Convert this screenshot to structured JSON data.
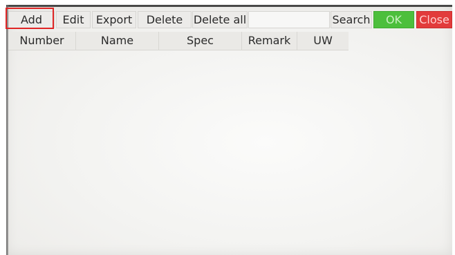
{
  "toolbar": {
    "add_label": "Add",
    "edit_label": "Edit",
    "export_label": "Export",
    "delete_label": "Delete",
    "delete_all_label": "Delete all",
    "search_value": "",
    "search_label": "Search",
    "ok_label": "OK",
    "close_label": "Close"
  },
  "table": {
    "columns": [
      "Number",
      "Name",
      "Spec",
      "Remark",
      "UW"
    ],
    "rows": []
  },
  "colors": {
    "ok_button": "#4cbf3c",
    "close_button": "#e23b3b",
    "highlight": "#e02525"
  }
}
